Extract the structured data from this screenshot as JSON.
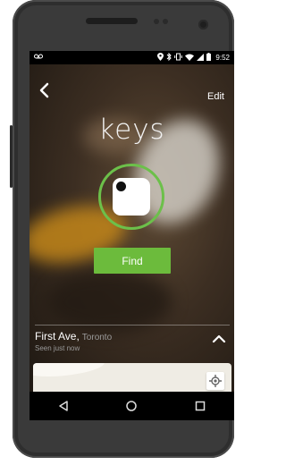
{
  "status_bar": {
    "left_icon": "voicemail-icon",
    "right_icons": [
      "location-icon",
      "bluetooth-icon",
      "vibrate-icon",
      "wifi-icon",
      "signal-icon",
      "battery-icon"
    ],
    "time": "9:52"
  },
  "header": {
    "back_icon": "back-chevron-icon",
    "edit_label": "Edit",
    "title": "keys"
  },
  "tile": {
    "ring_color": "#6cc04a",
    "find_label": "Find",
    "find_color": "#6cbb3c"
  },
  "location": {
    "street": "First Ave,",
    "city": "Toronto",
    "seen": "Seen just now",
    "expand_icon": "chevron-up-icon"
  },
  "map": {
    "locate_icon": "my-location-icon"
  },
  "navbar": {
    "icons": [
      "back-triangle-icon",
      "home-circle-icon",
      "recents-square-icon"
    ]
  }
}
